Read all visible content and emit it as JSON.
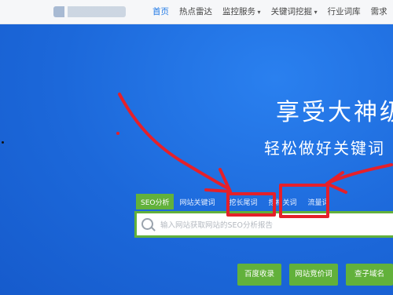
{
  "nav": {
    "items": [
      {
        "label": "首页",
        "active": true
      },
      {
        "label": "热点雷达"
      },
      {
        "label": "监控服务",
        "dropdown": true
      },
      {
        "label": "关键词挖掘",
        "dropdown": true
      },
      {
        "label": "行业词库"
      },
      {
        "label": "需求"
      }
    ]
  },
  "hero": {
    "headline": "享受大神级",
    "subline": "轻松做好关键词"
  },
  "search": {
    "tabs": [
      "SEO分析",
      "网站关键词",
      "挖长尾词",
      "挖相关词",
      "流量词"
    ],
    "placeholder": "输入网站获取网站的SEO分析报告"
  },
  "quick_buttons": [
    "百度收录",
    "网站竞价词",
    "查子域名"
  ],
  "colors": {
    "brand_blue": "#1e78e6",
    "accent_green": "#62b13b",
    "annotation_red": "#e5202a"
  }
}
